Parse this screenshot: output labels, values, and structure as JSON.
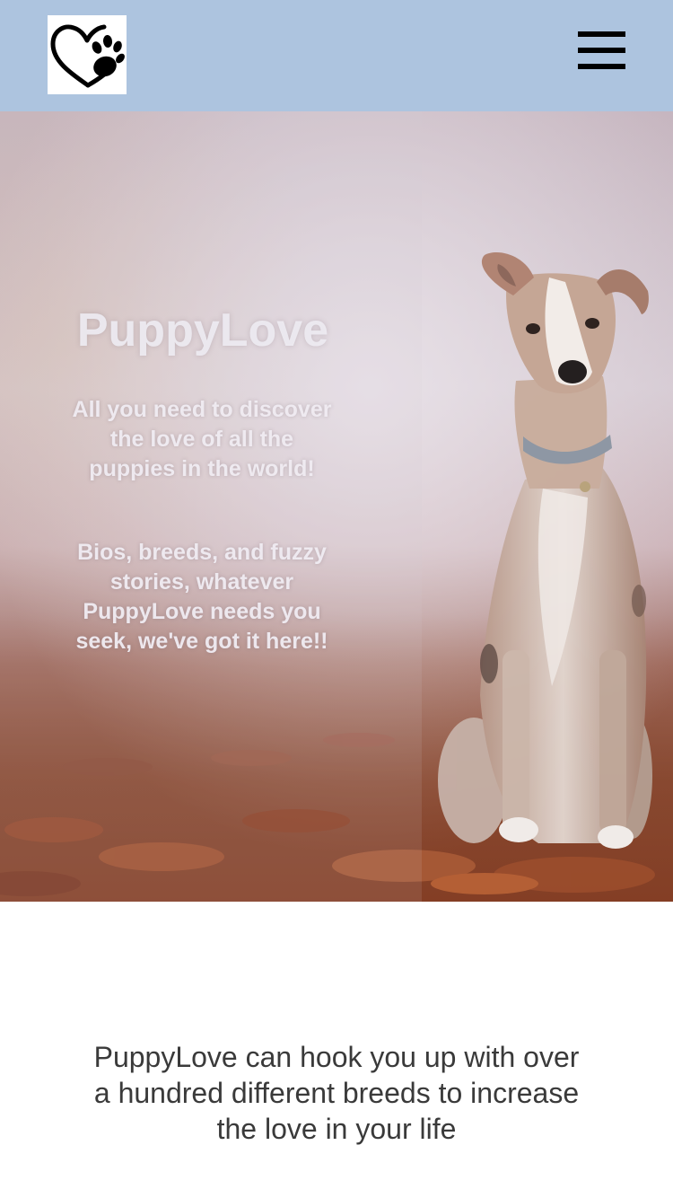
{
  "header": {
    "logo_icon": "heart-paw-icon",
    "menu_icon": "hamburger-menu-icon",
    "background_color": "#adc4df"
  },
  "hero": {
    "title": "PuppyLove",
    "tagline": "All you need to discover the love of all the puppies in the world!",
    "description": "Bios, breeds, and fuzzy stories, whatever PuppyLove needs you seek, we've got it here!!"
  },
  "intro": {
    "text": "PuppyLove can hook you up with over a hundred different breeds to increase the love in your life"
  }
}
